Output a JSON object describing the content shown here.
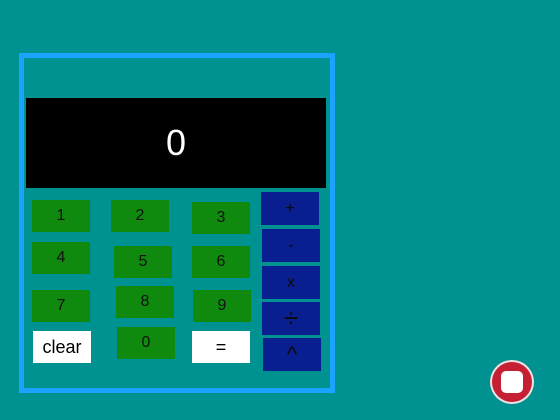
{
  "display": {
    "value": "0"
  },
  "keys": {
    "one": "1",
    "two": "2",
    "three": "3",
    "four": "4",
    "five": "5",
    "six": "6",
    "seven": "7",
    "eight": "8",
    "nine": "9",
    "zero": "0",
    "clear": "clear",
    "equals": "=",
    "plus": "+",
    "minus": "-",
    "multiply": "x",
    "divide": "÷",
    "power": "^"
  },
  "colors": {
    "background": "#009291",
    "panel_border": "#1aa3ff",
    "number_key": "#0f8a0f",
    "operator_key": "#0a1f8f",
    "display_bg": "#000000",
    "stop_button": "#c51f34"
  },
  "icons": {
    "stop": "stop-icon"
  }
}
